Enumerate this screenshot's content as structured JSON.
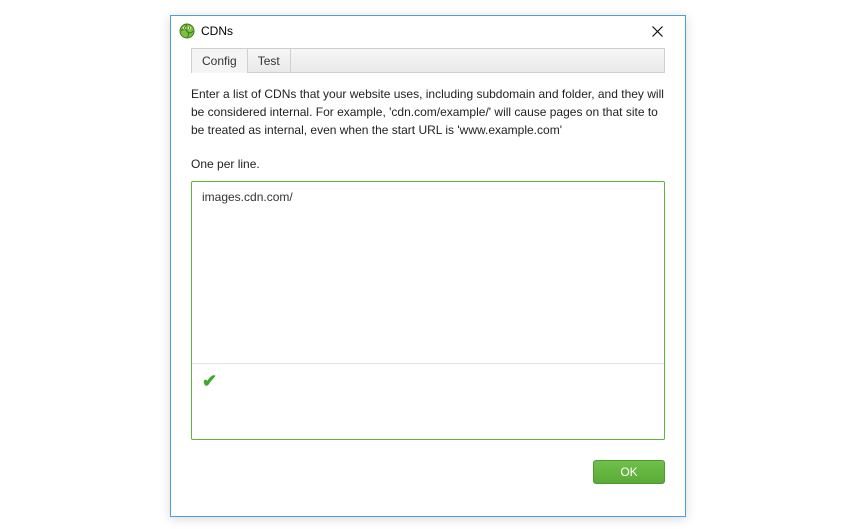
{
  "window": {
    "title": "CDNs"
  },
  "tabs": {
    "config": "Config",
    "test": "Test"
  },
  "description": "Enter a list of CDNs that your website uses, including subdomain and folder, and they will be considered internal. For example, 'cdn.com/example/' will cause pages on that site to be treated as internal, even when the start URL is 'www.example.com'",
  "sub_label": "One per line.",
  "textarea": {
    "value": "images.cdn.com/"
  },
  "buttons": {
    "ok": "OK"
  },
  "icons": {
    "app": "globe-frog-icon",
    "close": "close-icon",
    "status": "checkmark-icon"
  }
}
